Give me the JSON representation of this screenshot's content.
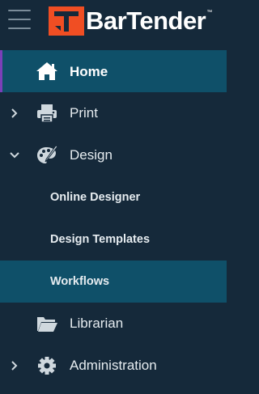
{
  "header": {
    "logo_text": "BarTender",
    "logo_tm": "™",
    "menu_icon": "hamburger-icon",
    "brand_color": "#f04e23"
  },
  "nav": {
    "items": [
      {
        "label": "Home",
        "icon": "home-icon",
        "active": true
      },
      {
        "label": "Print",
        "icon": "printer-icon",
        "expand": "chevron-right-icon"
      },
      {
        "label": "Design",
        "icon": "palette-icon",
        "expand": "chevron-down-icon"
      },
      {
        "label": "Online Designer"
      },
      {
        "label": "Design Templates"
      },
      {
        "label": "Workflows",
        "active": true
      },
      {
        "label": "Librarian",
        "icon": "folder-icon"
      },
      {
        "label": "Administration",
        "icon": "gear-icon",
        "expand": "chevron-right-icon"
      }
    ]
  },
  "colors": {
    "background": "#15293a",
    "active_background": "#0f5069",
    "active_accent": "#7b3fb8"
  }
}
